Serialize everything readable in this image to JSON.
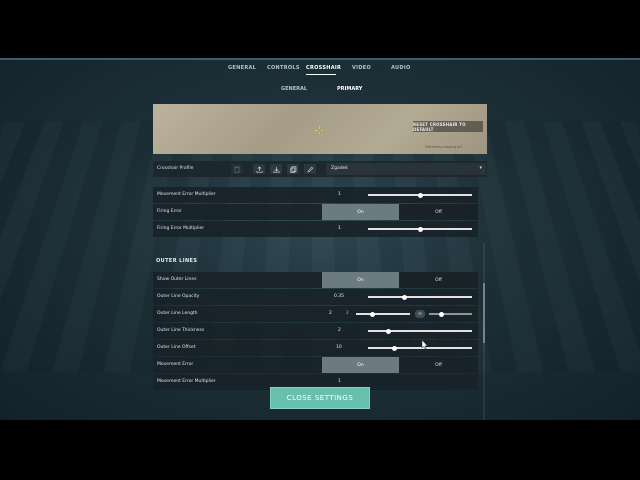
{
  "nav": {
    "tabs": [
      {
        "label": "GENERAL"
      },
      {
        "label": "CONTROLS"
      },
      {
        "label": "CROSSHAIR"
      },
      {
        "label": "VIDEO"
      },
      {
        "label": "AUDIO"
      }
    ],
    "active": "CROSSHAIR"
  },
  "subnav": {
    "tabs": [
      {
        "label": "GENERAL"
      },
      {
        "label": "PRIMARY"
      }
    ],
    "active": "PRIMARY"
  },
  "preview": {
    "reset_label": "RESET CROSSHAIR TO DEFAULT",
    "elements_link": "Elements missing or?",
    "crosshair_color": "#d8d52a"
  },
  "profile": {
    "label": "Crosshair Profile",
    "selected": "Zgadek",
    "icons": [
      "trash-icon",
      "upload-icon",
      "download-icon",
      "copy-icon",
      "edit-icon"
    ]
  },
  "settings": {
    "movement_error_multiplier": {
      "label": "Movement Error Multiplier",
      "value": "1",
      "level": 0.5
    },
    "firing_error": {
      "label": "Firing Error",
      "on_label": "On",
      "off_label": "Off",
      "state": "On"
    },
    "firing_error_multiplier": {
      "label": "Firing Error Multiplier",
      "value": "1",
      "level": 0.5
    },
    "outer_lines_title": "OUTER LINES",
    "show_outer_lines": {
      "label": "Show Outer Lines",
      "on_label": "On",
      "off_label": "Off",
      "state": "On"
    },
    "outer_line_opacity": {
      "label": "Outer Line Opacity",
      "value": "0.35",
      "level": 0.35
    },
    "outer_line_length": {
      "label": "Outer Line Length",
      "value": "2",
      "value2": "2",
      "level": 0.3,
      "level2": 0.3
    },
    "outer_line_thickness": {
      "label": "Outer Line Thickness",
      "value": "2",
      "level": 0.2
    },
    "outer_line_offset": {
      "label": "Outer Line Offset",
      "value": "10",
      "level": 0.25
    },
    "movement_error": {
      "label": "Movement Error",
      "on_label": "On",
      "off_label": "Off",
      "state": "On"
    },
    "movement_error_multiplier_2": {
      "label": "Movement Error Multiplier",
      "value": "1"
    }
  },
  "close_button": "CLOSE SETTINGS",
  "colors": {
    "accent": "#67bfae",
    "toggle_active": "#6c7b80"
  }
}
